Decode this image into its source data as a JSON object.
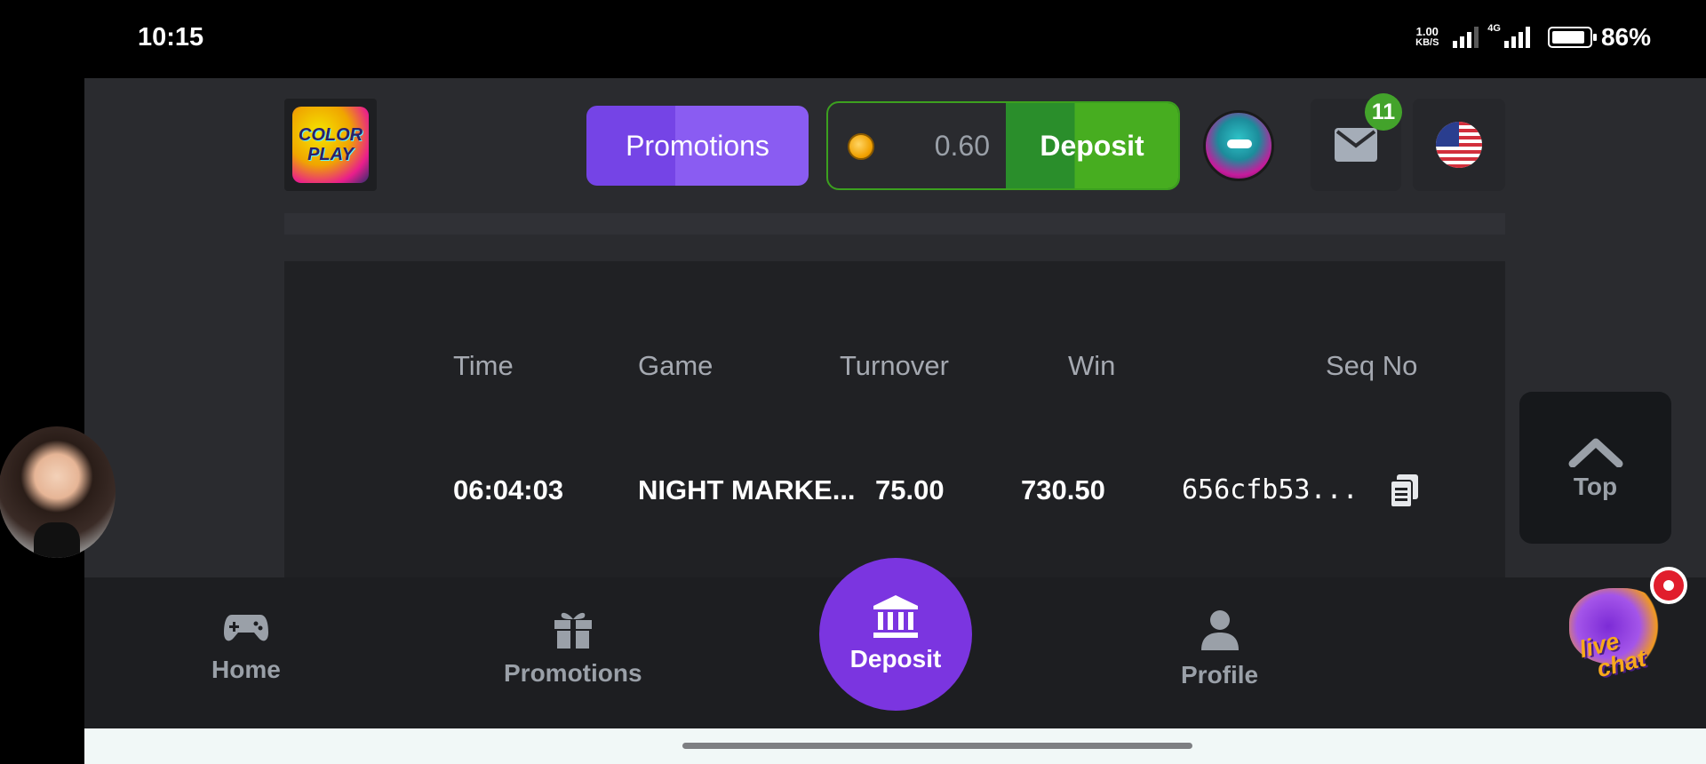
{
  "status_bar": {
    "time": "10:15",
    "net_speed_value": "1.00",
    "net_speed_unit": "KB/S",
    "network_type": "4G",
    "battery": "86%"
  },
  "header": {
    "logo_text_top": "COLOR",
    "logo_text_bottom": "PLAY",
    "promotions_label": "Promotions",
    "balance": "0.60",
    "deposit_label": "Deposit",
    "mail_badge": "11"
  },
  "table": {
    "columns": [
      "Time",
      "Game",
      "Turnover",
      "Win",
      "Seq No"
    ],
    "rows": [
      {
        "time": "06:04:03",
        "game": "NIGHT MARKE...",
        "turnover": "75.00",
        "win": "730.50",
        "seq_no": "656cfb53..."
      }
    ]
  },
  "top_button": {
    "label": "Top"
  },
  "bottom_nav": {
    "home": "Home",
    "promotions": "Promotions",
    "deposit": "Deposit",
    "profile": "Profile"
  },
  "livechat": {
    "line1": "live",
    "line2": "chat"
  },
  "colors": {
    "accent_purple": "#7b35e0",
    "deposit_green": "#47ad20",
    "background": "#2a2b2f"
  },
  "icons": [
    "signal-icon",
    "battery-icon",
    "coin-icon",
    "mail-icon",
    "us-flag-icon",
    "chevron-up-icon",
    "copy-icon",
    "gamepad-icon",
    "gift-icon",
    "bank-icon",
    "user-icon"
  ]
}
